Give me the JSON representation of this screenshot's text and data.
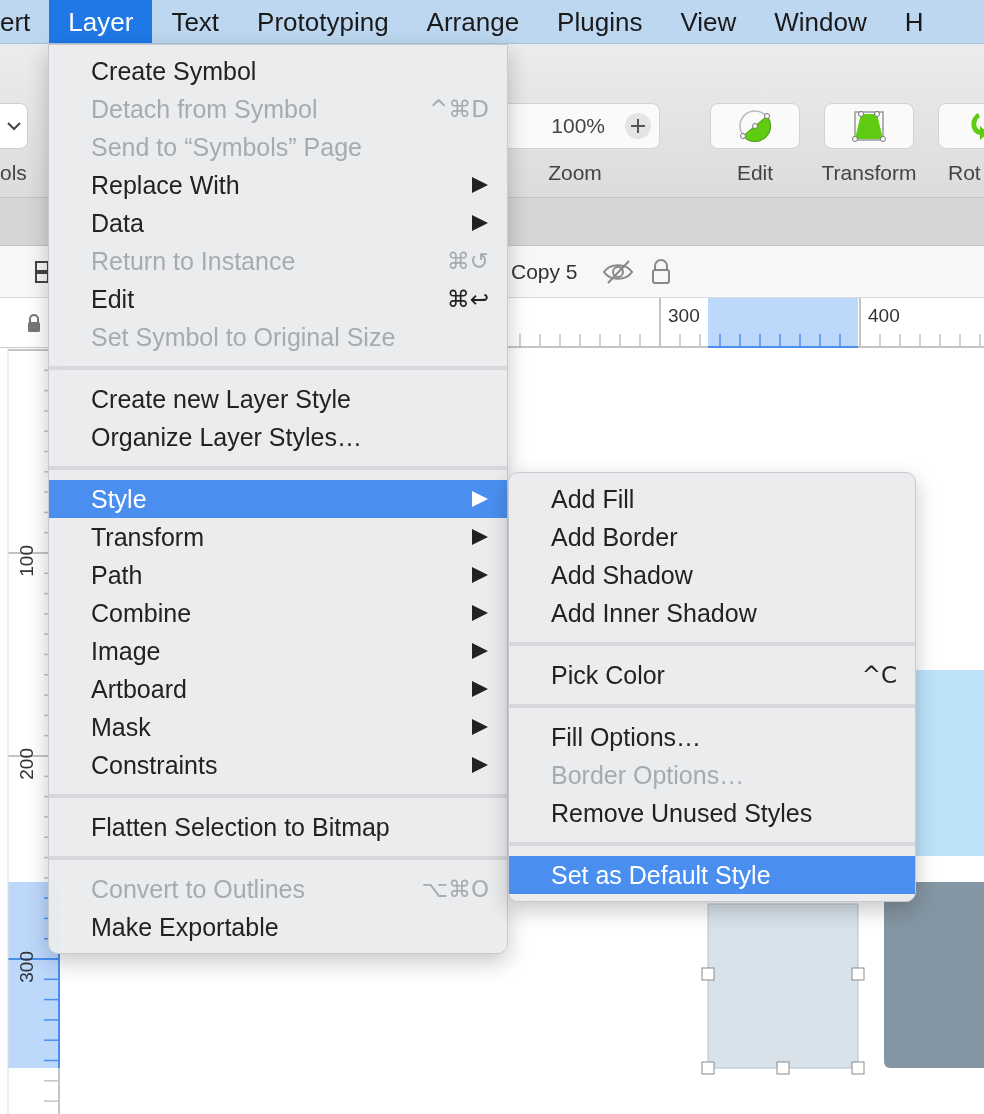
{
  "menu_bar": {
    "items": [
      {
        "label": "ert",
        "selected": false
      },
      {
        "label": "Layer",
        "selected": true
      },
      {
        "label": "Text",
        "selected": false
      },
      {
        "label": "Prototyping",
        "selected": false
      },
      {
        "label": "Arrange",
        "selected": false
      },
      {
        "label": "Plugins",
        "selected": false
      },
      {
        "label": "View",
        "selected": false
      },
      {
        "label": "Window",
        "selected": false
      },
      {
        "label": "H",
        "selected": false
      }
    ]
  },
  "toolbar": {
    "dropdown_label": "ols",
    "zoom": {
      "value": "100%",
      "label": "Zoom"
    },
    "buttons": [
      {
        "kind": "edit",
        "label": "Edit"
      },
      {
        "kind": "transform",
        "label": "Transform"
      },
      {
        "kind": "rotate",
        "label": "Rot"
      }
    ]
  },
  "layer_bar": {
    "name": "Copy 5"
  },
  "ruler_top": {
    "labels": [
      "300",
      "400"
    ]
  },
  "ruler_left": {
    "labels": [
      "100",
      "200",
      "300"
    ]
  },
  "layer_menu": {
    "items": [
      {
        "kind": "item",
        "label": "Create Symbol",
        "disabled": false,
        "selected": false
      },
      {
        "kind": "item",
        "label": "Detach from Symbol",
        "shortcut": "^⌘D",
        "disabled": true,
        "selected": false
      },
      {
        "kind": "item",
        "label": "Send to “Symbols” Page",
        "disabled": true,
        "selected": false
      },
      {
        "kind": "item",
        "label": "Replace With",
        "submenu": true,
        "disabled": false,
        "selected": false
      },
      {
        "kind": "item",
        "label": "Data",
        "submenu": true,
        "disabled": false,
        "selected": false
      },
      {
        "kind": "item",
        "label": "Return to Instance",
        "shortcut": "⌘↺",
        "disabled": true,
        "selected": false
      },
      {
        "kind": "item",
        "label": "Edit",
        "shortcut": "⌘↩",
        "disabled": false,
        "selected": false
      },
      {
        "kind": "item",
        "label": "Set Symbol to Original Size",
        "disabled": true,
        "selected": false
      },
      {
        "kind": "separator"
      },
      {
        "kind": "item",
        "label": "Create new Layer Style",
        "disabled": false,
        "selected": false
      },
      {
        "kind": "item",
        "label": "Organize Layer Styles…",
        "disabled": false,
        "selected": false
      },
      {
        "kind": "separator"
      },
      {
        "kind": "item",
        "label": "Style",
        "submenu": true,
        "disabled": false,
        "selected": true
      },
      {
        "kind": "item",
        "label": "Transform",
        "submenu": true,
        "disabled": false,
        "selected": false
      },
      {
        "kind": "item",
        "label": "Path",
        "submenu": true,
        "disabled": false,
        "selected": false
      },
      {
        "kind": "item",
        "label": "Combine",
        "submenu": true,
        "disabled": false,
        "selected": false
      },
      {
        "kind": "item",
        "label": "Image",
        "submenu": true,
        "disabled": false,
        "selected": false
      },
      {
        "kind": "item",
        "label": "Artboard",
        "submenu": true,
        "disabled": false,
        "selected": false
      },
      {
        "kind": "item",
        "label": "Mask",
        "submenu": true,
        "disabled": false,
        "selected": false
      },
      {
        "kind": "item",
        "label": "Constraints",
        "submenu": true,
        "disabled": false,
        "selected": false
      },
      {
        "kind": "separator"
      },
      {
        "kind": "item",
        "label": "Flatten Selection to Bitmap",
        "disabled": false,
        "selected": false
      },
      {
        "kind": "separator"
      },
      {
        "kind": "item",
        "label": "Convert to Outlines",
        "shortcut": "⌥⌘O",
        "disabled": true,
        "selected": false
      },
      {
        "kind": "item",
        "label": "Make Exportable",
        "disabled": false,
        "selected": false
      }
    ]
  },
  "style_submenu": {
    "items": [
      {
        "kind": "item",
        "label": "Add Fill",
        "disabled": false,
        "selected": false
      },
      {
        "kind": "item",
        "label": "Add Border",
        "disabled": false,
        "selected": false
      },
      {
        "kind": "item",
        "label": "Add Shadow",
        "disabled": false,
        "selected": false
      },
      {
        "kind": "item",
        "label": "Add Inner Shadow",
        "disabled": false,
        "selected": false
      },
      {
        "kind": "separator"
      },
      {
        "kind": "item",
        "label": "Pick Color",
        "shortcut": "^C",
        "disabled": false,
        "selected": false
      },
      {
        "kind": "separator"
      },
      {
        "kind": "item",
        "label": "Fill Options…",
        "disabled": false,
        "selected": false
      },
      {
        "kind": "item",
        "label": "Border Options…",
        "disabled": true,
        "selected": false
      },
      {
        "kind": "item",
        "label": "Remove Unused Styles",
        "disabled": false,
        "selected": false
      },
      {
        "kind": "separator"
      },
      {
        "kind": "item",
        "label": "Set as Default Style",
        "disabled": false,
        "selected": true
      }
    ]
  }
}
